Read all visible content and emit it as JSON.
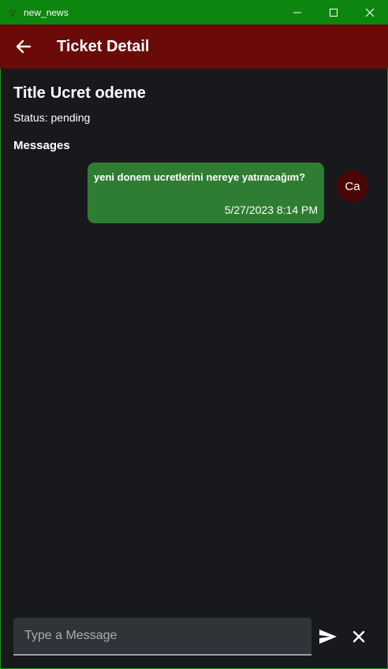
{
  "window": {
    "title": "new_news",
    "icons": {
      "app": "app-icon",
      "minimize": "minimize-icon",
      "maximize": "maximize-icon",
      "close": "close-icon"
    },
    "frame_color": "#0d860f"
  },
  "appbar": {
    "title": "Ticket Detail",
    "back_icon": "arrow-left-icon",
    "color": "#6a0b09"
  },
  "ticket": {
    "title_label": "Title",
    "title_value": "Ucret odeme",
    "status_text": "Status: pending"
  },
  "messages": {
    "heading": "Messages",
    "items": [
      {
        "text": "yeni donem ucretlerini nereye yatıracağım?",
        "timestamp": "5/27/2023 8:14 PM",
        "avatar_initials": "Ca",
        "bubble_color": "#2e7d32"
      }
    ]
  },
  "composer": {
    "placeholder": "Type a Message",
    "value": "",
    "send_icon": "send-icon",
    "clear_icon": "close-icon"
  }
}
